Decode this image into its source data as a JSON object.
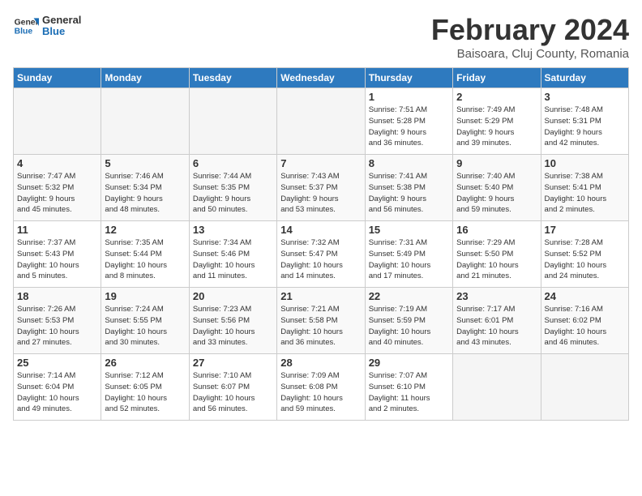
{
  "header": {
    "logo_general": "General",
    "logo_blue": "Blue",
    "title": "February 2024",
    "subtitle": "Baisoara, Cluj County, Romania"
  },
  "columns": [
    "Sunday",
    "Monday",
    "Tuesday",
    "Wednesday",
    "Thursday",
    "Friday",
    "Saturday"
  ],
  "weeks": [
    [
      {
        "num": "",
        "info": "",
        "empty": true
      },
      {
        "num": "",
        "info": "",
        "empty": true
      },
      {
        "num": "",
        "info": "",
        "empty": true
      },
      {
        "num": "",
        "info": "",
        "empty": true
      },
      {
        "num": "1",
        "info": "Sunrise: 7:51 AM\nSunset: 5:28 PM\nDaylight: 9 hours\nand 36 minutes."
      },
      {
        "num": "2",
        "info": "Sunrise: 7:49 AM\nSunset: 5:29 PM\nDaylight: 9 hours\nand 39 minutes."
      },
      {
        "num": "3",
        "info": "Sunrise: 7:48 AM\nSunset: 5:31 PM\nDaylight: 9 hours\nand 42 minutes."
      }
    ],
    [
      {
        "num": "4",
        "info": "Sunrise: 7:47 AM\nSunset: 5:32 PM\nDaylight: 9 hours\nand 45 minutes."
      },
      {
        "num": "5",
        "info": "Sunrise: 7:46 AM\nSunset: 5:34 PM\nDaylight: 9 hours\nand 48 minutes."
      },
      {
        "num": "6",
        "info": "Sunrise: 7:44 AM\nSunset: 5:35 PM\nDaylight: 9 hours\nand 50 minutes."
      },
      {
        "num": "7",
        "info": "Sunrise: 7:43 AM\nSunset: 5:37 PM\nDaylight: 9 hours\nand 53 minutes."
      },
      {
        "num": "8",
        "info": "Sunrise: 7:41 AM\nSunset: 5:38 PM\nDaylight: 9 hours\nand 56 minutes."
      },
      {
        "num": "9",
        "info": "Sunrise: 7:40 AM\nSunset: 5:40 PM\nDaylight: 9 hours\nand 59 minutes."
      },
      {
        "num": "10",
        "info": "Sunrise: 7:38 AM\nSunset: 5:41 PM\nDaylight: 10 hours\nand 2 minutes."
      }
    ],
    [
      {
        "num": "11",
        "info": "Sunrise: 7:37 AM\nSunset: 5:43 PM\nDaylight: 10 hours\nand 5 minutes."
      },
      {
        "num": "12",
        "info": "Sunrise: 7:35 AM\nSunset: 5:44 PM\nDaylight: 10 hours\nand 8 minutes."
      },
      {
        "num": "13",
        "info": "Sunrise: 7:34 AM\nSunset: 5:46 PM\nDaylight: 10 hours\nand 11 minutes."
      },
      {
        "num": "14",
        "info": "Sunrise: 7:32 AM\nSunset: 5:47 PM\nDaylight: 10 hours\nand 14 minutes."
      },
      {
        "num": "15",
        "info": "Sunrise: 7:31 AM\nSunset: 5:49 PM\nDaylight: 10 hours\nand 17 minutes."
      },
      {
        "num": "16",
        "info": "Sunrise: 7:29 AM\nSunset: 5:50 PM\nDaylight: 10 hours\nand 21 minutes."
      },
      {
        "num": "17",
        "info": "Sunrise: 7:28 AM\nSunset: 5:52 PM\nDaylight: 10 hours\nand 24 minutes."
      }
    ],
    [
      {
        "num": "18",
        "info": "Sunrise: 7:26 AM\nSunset: 5:53 PM\nDaylight: 10 hours\nand 27 minutes."
      },
      {
        "num": "19",
        "info": "Sunrise: 7:24 AM\nSunset: 5:55 PM\nDaylight: 10 hours\nand 30 minutes."
      },
      {
        "num": "20",
        "info": "Sunrise: 7:23 AM\nSunset: 5:56 PM\nDaylight: 10 hours\nand 33 minutes."
      },
      {
        "num": "21",
        "info": "Sunrise: 7:21 AM\nSunset: 5:58 PM\nDaylight: 10 hours\nand 36 minutes."
      },
      {
        "num": "22",
        "info": "Sunrise: 7:19 AM\nSunset: 5:59 PM\nDaylight: 10 hours\nand 40 minutes."
      },
      {
        "num": "23",
        "info": "Sunrise: 7:17 AM\nSunset: 6:01 PM\nDaylight: 10 hours\nand 43 minutes."
      },
      {
        "num": "24",
        "info": "Sunrise: 7:16 AM\nSunset: 6:02 PM\nDaylight: 10 hours\nand 46 minutes."
      }
    ],
    [
      {
        "num": "25",
        "info": "Sunrise: 7:14 AM\nSunset: 6:04 PM\nDaylight: 10 hours\nand 49 minutes."
      },
      {
        "num": "26",
        "info": "Sunrise: 7:12 AM\nSunset: 6:05 PM\nDaylight: 10 hours\nand 52 minutes."
      },
      {
        "num": "27",
        "info": "Sunrise: 7:10 AM\nSunset: 6:07 PM\nDaylight: 10 hours\nand 56 minutes."
      },
      {
        "num": "28",
        "info": "Sunrise: 7:09 AM\nSunset: 6:08 PM\nDaylight: 10 hours\nand 59 minutes."
      },
      {
        "num": "29",
        "info": "Sunrise: 7:07 AM\nSunset: 6:10 PM\nDaylight: 11 hours\nand 2 minutes."
      },
      {
        "num": "",
        "info": "",
        "empty": true
      },
      {
        "num": "",
        "info": "",
        "empty": true
      }
    ]
  ]
}
